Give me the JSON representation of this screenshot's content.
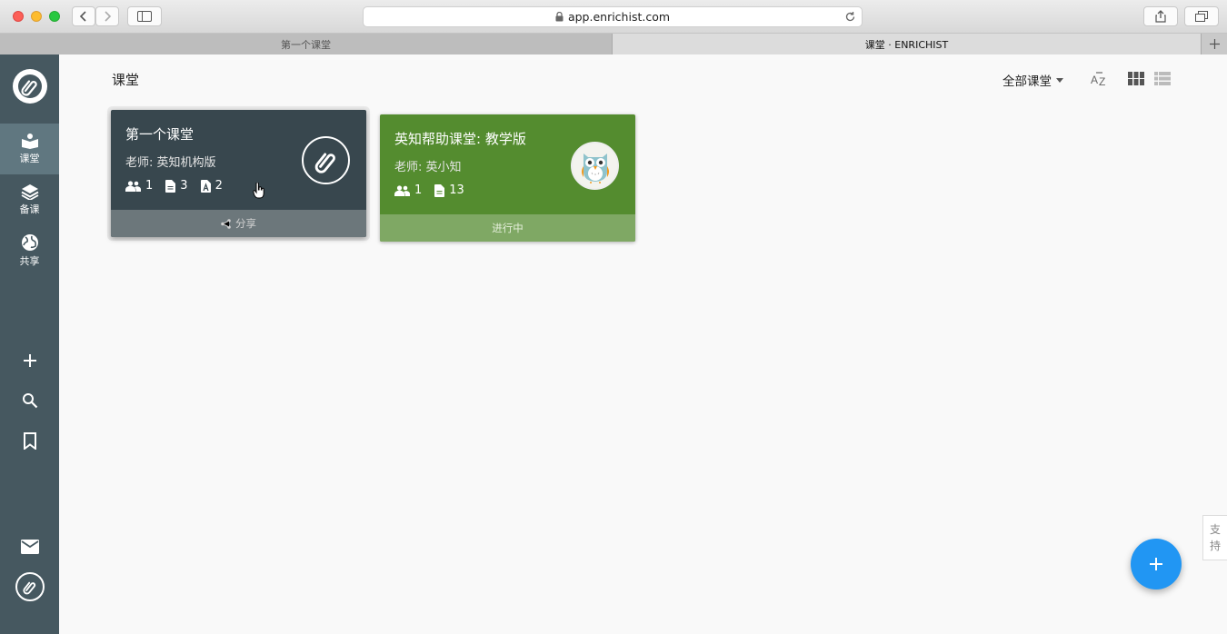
{
  "browser": {
    "url": "app.enrichist.com",
    "tabs": [
      {
        "label": "第一个课堂"
      },
      {
        "label": "课堂 · ENRICHIST"
      }
    ]
  },
  "sidebar": {
    "items": [
      {
        "label": "课堂",
        "icon": "classroom-icon",
        "active": true
      },
      {
        "label": "备课",
        "icon": "layers-icon"
      },
      {
        "label": "共享",
        "icon": "globe-icon"
      }
    ],
    "tools": [
      "add-icon",
      "search-icon",
      "bookmark-icon"
    ],
    "bottom": [
      "mail-icon",
      "avatar"
    ]
  },
  "header": {
    "title": "课堂",
    "filter_label": "全部课堂"
  },
  "cards": [
    {
      "title": "第一个课堂",
      "teacher": "老师: 英知机构版",
      "students": "1",
      "documents": "3",
      "assignments": "2",
      "footer": "分享",
      "color": "#38474e"
    },
    {
      "title": "英知帮助课堂: 教学版",
      "teacher": "老师: 英小知",
      "students": "1",
      "documents": "13",
      "footer": "进行中",
      "color": "#548c2f"
    }
  ],
  "support": {
    "label_1": "支",
    "label_2": "持"
  },
  "colors": {
    "accent": "#2196f3",
    "sidebar": "#465860"
  }
}
